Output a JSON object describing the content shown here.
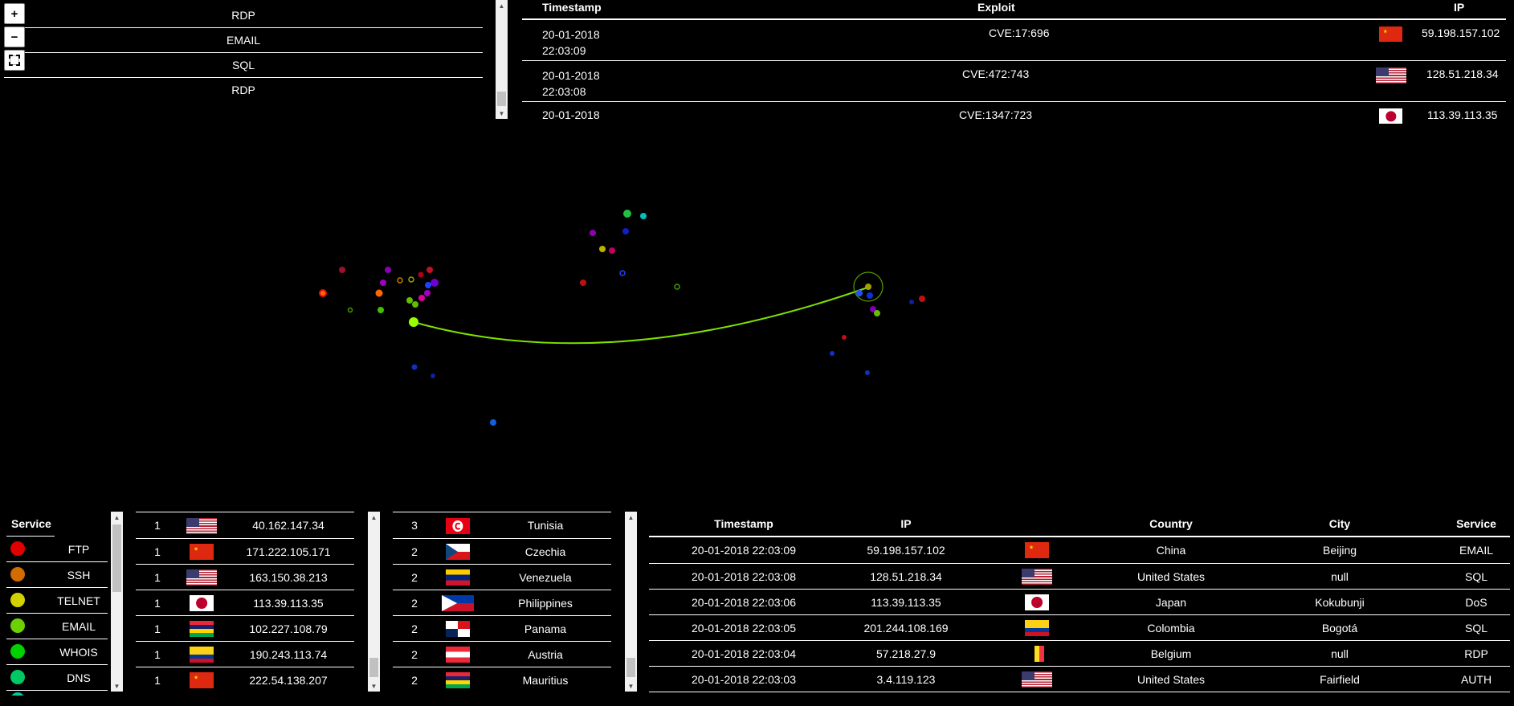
{
  "map_controls": {
    "zoom_in": "+",
    "zoom_out": "−"
  },
  "top_services": [
    "RDP",
    "EMAIL",
    "SQL",
    "RDP"
  ],
  "exploits": {
    "headers": {
      "timestamp": "Timestamp",
      "exploit": "Exploit",
      "ip": "IP"
    },
    "rows": [
      {
        "date": "20-01-2018",
        "time": "22:03:09",
        "exploit": "CVE:17:696",
        "flag": "cn",
        "ip": "59.198.157.102"
      },
      {
        "date": "20-01-2018",
        "time": "22:03:08",
        "exploit": "CVE:472:743",
        "flag": "us",
        "ip": "128.51.218.34"
      },
      {
        "date": "20-01-2018",
        "time": "",
        "exploit": "CVE:1347:723",
        "flag": "jp",
        "ip": "113.39.113.35"
      }
    ]
  },
  "legend": {
    "header": "Service",
    "items": [
      {
        "name": "FTP",
        "color": "#ff0000"
      },
      {
        "name": "SSH",
        "color": "#ff8000"
      },
      {
        "name": "TELNET",
        "color": "#ffff00"
      },
      {
        "name": "EMAIL",
        "color": "#80ff00"
      },
      {
        "name": "WHOIS",
        "color": "#00ff00"
      },
      {
        "name": "DNS",
        "color": "#00ff80"
      }
    ]
  },
  "attackers": [
    {
      "count": "1",
      "flag": "us",
      "ip": "40.162.147.34"
    },
    {
      "count": "1",
      "flag": "cn",
      "ip": "171.222.105.171"
    },
    {
      "count": "1",
      "flag": "us",
      "ip": "163.150.38.213"
    },
    {
      "count": "1",
      "flag": "jp",
      "ip": "113.39.113.35"
    },
    {
      "count": "1",
      "flag": "mu",
      "ip": "102.227.108.79"
    },
    {
      "count": "1",
      "flag": "co",
      "ip": "190.243.113.74"
    },
    {
      "count": "1",
      "flag": "cn",
      "ip": "222.54.138.207"
    }
  ],
  "countries": [
    {
      "count": "3",
      "flag": "tn",
      "name": "Tunisia"
    },
    {
      "count": "2",
      "flag": "cz",
      "name": "Czechia"
    },
    {
      "count": "2",
      "flag": "ve",
      "name": "Venezuela"
    },
    {
      "count": "2",
      "flag": "ph",
      "name": "Philippines"
    },
    {
      "count": "2",
      "flag": "pa",
      "name": "Panama"
    },
    {
      "count": "2",
      "flag": "at",
      "name": "Austria"
    },
    {
      "count": "2",
      "flag": "mu",
      "name": "Mauritius"
    }
  ],
  "recent": {
    "headers": {
      "timestamp": "Timestamp",
      "ip": "IP",
      "country": "Country",
      "city": "City",
      "service": "Service"
    },
    "rows": [
      {
        "timestamp": "20-01-2018 22:03:09",
        "ip": "59.198.157.102",
        "flag": "cn",
        "country": "China",
        "city": "Beijing",
        "service": "EMAIL"
      },
      {
        "timestamp": "20-01-2018 22:03:08",
        "ip": "128.51.218.34",
        "flag": "us",
        "country": "United States",
        "city": "null",
        "service": "SQL"
      },
      {
        "timestamp": "20-01-2018 22:03:06",
        "ip": "113.39.113.35",
        "flag": "jp",
        "country": "Japan",
        "city": "Kokubunji",
        "service": "DoS"
      },
      {
        "timestamp": "20-01-2018 22:03:05",
        "ip": "201.244.108.169",
        "flag": "co",
        "country": "Colombia",
        "city": "Bogotá",
        "service": "SQL"
      },
      {
        "timestamp": "20-01-2018 22:03:04",
        "ip": "57.218.27.9",
        "flag": "be",
        "country": "Belgium",
        "city": "null",
        "service": "RDP"
      },
      {
        "timestamp": "20-01-2018 22:03:03",
        "ip": "3.4.119.123",
        "flag": "us",
        "country": "United States",
        "city": "Fairfield",
        "service": "AUTH"
      }
    ]
  },
  "scroll_icons": {
    "up": "▲",
    "down": "▼"
  }
}
